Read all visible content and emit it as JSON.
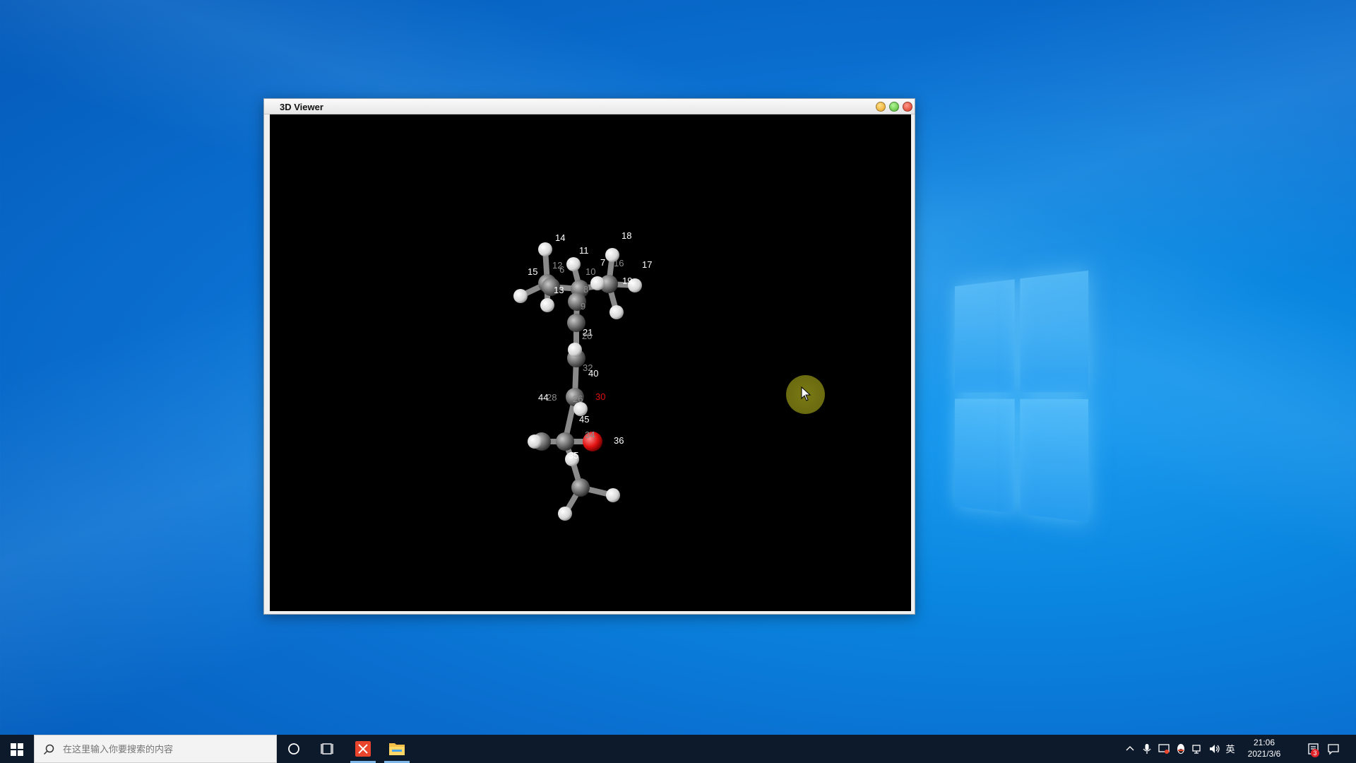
{
  "window": {
    "title": "3D Viewer",
    "buttons": {
      "minimize": "minimize-icon",
      "maximize": "maximize-icon",
      "close": "close-icon"
    }
  },
  "molecule": {
    "highlight_color": "#e01010",
    "atoms": [
      {
        "label": "14",
        "kind": "H"
      },
      {
        "label": "11",
        "kind": "H"
      },
      {
        "label": "18",
        "kind": "H"
      },
      {
        "label": "17",
        "kind": "H"
      },
      {
        "label": "15",
        "kind": "H"
      },
      {
        "label": "13",
        "kind": "H"
      },
      {
        "label": "12",
        "kind": "C"
      },
      {
        "label": "6",
        "kind": "C"
      },
      {
        "label": "10",
        "kind": "C"
      },
      {
        "label": "7",
        "kind": "H"
      },
      {
        "label": "16",
        "kind": "C"
      },
      {
        "label": "19",
        "kind": "H"
      },
      {
        "label": "8",
        "kind": "C"
      },
      {
        "label": "9",
        "kind": "C"
      },
      {
        "label": "21",
        "kind": "H"
      },
      {
        "label": "20",
        "kind": "C"
      },
      {
        "label": "32",
        "kind": "C"
      },
      {
        "label": "40",
        "kind": "H"
      },
      {
        "label": "44",
        "kind": "H"
      },
      {
        "label": "28",
        "kind": "C"
      },
      {
        "label": "26",
        "kind": "C"
      },
      {
        "label": "30",
        "kind": "O"
      },
      {
        "label": "45",
        "kind": "H"
      },
      {
        "label": "34",
        "kind": "C"
      },
      {
        "label": "36",
        "kind": "H"
      },
      {
        "label": "35",
        "kind": "H"
      }
    ]
  },
  "taskbar": {
    "search_placeholder": "在这里输入你要搜索的内容",
    "ime_label": "英",
    "time": "21:06",
    "date": "2021/3/6",
    "notification_count": "3"
  }
}
